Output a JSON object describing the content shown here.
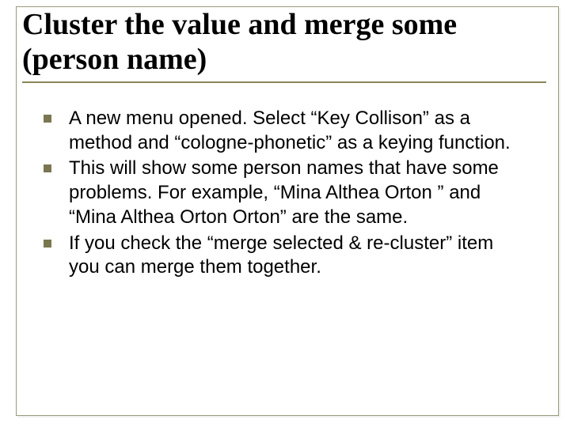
{
  "title": "Cluster the value and merge some (person name)",
  "bullets": [
    "A new menu opened. Select “Key Collison” as a method and “cologne-phonetic” as a keying function.",
    "This will show some person names that have some problems. For example, “Mina Althea Orton ” and “Mina Althea Orton Orton” are the same.",
    " If you check the “merge selected & re-cluster” item you can merge them together."
  ]
}
